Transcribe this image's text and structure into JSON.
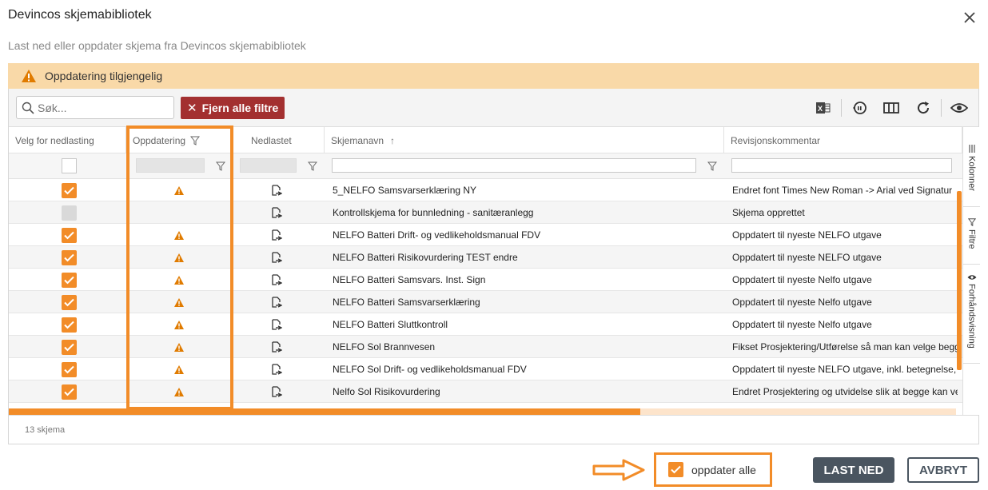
{
  "dialog": {
    "title": "Devincos skjemabibliotek",
    "subtitle": "Last ned eller oppdater skjema fra Devincos skjemabibliotek"
  },
  "banner": {
    "text": "Oppdatering tilgjengelig"
  },
  "toolbar": {
    "search_placeholder": "Søk...",
    "remove_filters_label": "Fjern alle filtre",
    "icons": [
      "excel-export-icon",
      "history-icon",
      "columns-icon",
      "refresh-icon",
      "eye-icon"
    ]
  },
  "columns": {
    "select": "Velg for nedlasting",
    "update": "Oppdatering",
    "downloaded": "Nedlastet",
    "name": "Skjemanavn",
    "comment": "Revisjonskommentar"
  },
  "rows": [
    {
      "checked": true,
      "update": true,
      "name": "5_NELFO Samsvarserklæring NY",
      "comment": "Endret font Times New Roman -> Arial ved Signatur"
    },
    {
      "checked": false,
      "update": false,
      "name": "Kontrollskjema for bunnledning - sanitæranlegg",
      "comment": "Skjema opprettet"
    },
    {
      "checked": true,
      "update": true,
      "name": "NELFO Batteri Drift- og vedlikeholdsmanual FDV",
      "comment": "Oppdatert til nyeste NELFO utgave"
    },
    {
      "checked": true,
      "update": true,
      "name": "NELFO Batteri Risikovurdering TEST endre",
      "comment": "Oppdatert til nyeste NELFO utgave"
    },
    {
      "checked": true,
      "update": true,
      "name": "NELFO Batteri Samsvars. Inst. Sign",
      "comment": "Oppdatert til nyeste Nelfo utgave"
    },
    {
      "checked": true,
      "update": true,
      "name": "NELFO Batteri Samsvarserklæring",
      "comment": "Oppdatert til nyeste Nelfo utgave"
    },
    {
      "checked": true,
      "update": true,
      "name": "NELFO Batteri Sluttkontroll",
      "comment": "Oppdatert til nyeste Nelfo utgave"
    },
    {
      "checked": true,
      "update": true,
      "name": "NELFO Sol Brannvesen",
      "comment": "Fikset Prosjektering/Utførelse så man kan velge begg"
    },
    {
      "checked": true,
      "update": true,
      "name": "NELFO Sol Drift- og vedlikeholdsmanual FDV",
      "comment": "Oppdatert til nyeste NELFO utgave, inkl. betegnelse, o"
    },
    {
      "checked": true,
      "update": true,
      "name": "Nelfo Sol Risikovurdering",
      "comment": "Endret Prosjektering og utvidelse slik at begge kan ve"
    }
  ],
  "side_tabs": [
    "Kolonner",
    "Filtre",
    "Forhåndsvisning"
  ],
  "footer": {
    "count": "13 skjema"
  },
  "update_all": {
    "label": "oppdater alle",
    "checked": true
  },
  "buttons": {
    "download": "LAST NED",
    "cancel": "AVBRYT"
  },
  "colors": {
    "accent": "#f28c28",
    "danger": "#a33030",
    "primary_button": "#4a5560",
    "banner_bg": "#f9d9a8"
  }
}
